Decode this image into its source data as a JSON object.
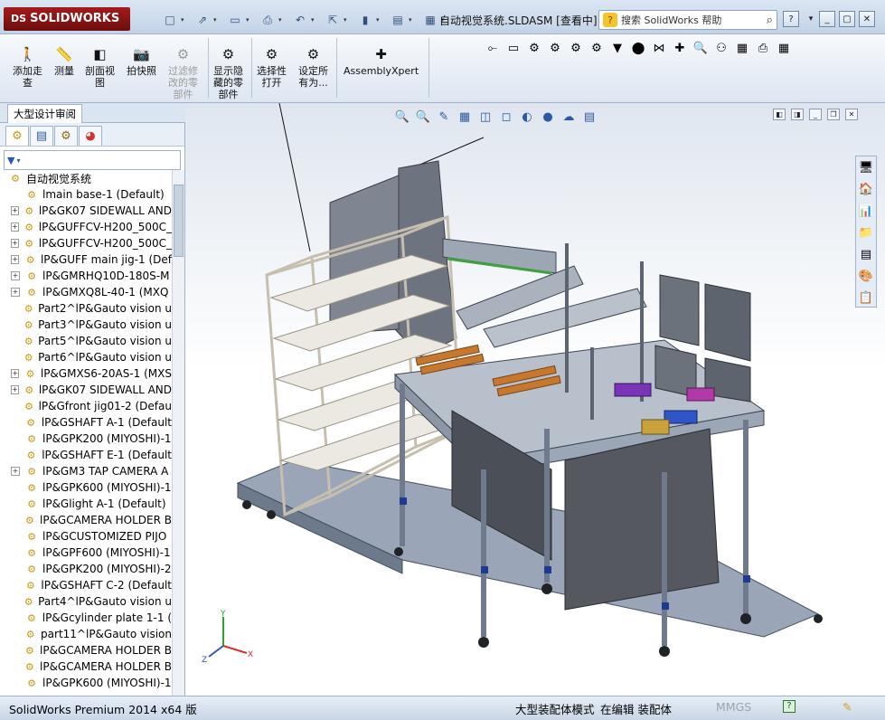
{
  "app": {
    "logo_text": "SOLIDWORKS",
    "logo_mark": "DS",
    "document_title": "自动视觉系统.SLDASM [查看中]",
    "help_search_placeholder": "搜索 SolidWorks 帮助",
    "help_icon_glyph": "?"
  },
  "quick_access": [
    {
      "name": "new-document-button",
      "glyph": "□"
    },
    {
      "name": "open-button",
      "glyph": "⇗"
    },
    {
      "name": "save-button",
      "glyph": "▭"
    },
    {
      "name": "print-button",
      "glyph": "⎙"
    },
    {
      "name": "undo-button",
      "glyph": "↶"
    },
    {
      "name": "select-button",
      "glyph": "⇱"
    },
    {
      "name": "rebuild-button",
      "glyph": "▮"
    },
    {
      "name": "file-properties-button",
      "glyph": "▤"
    },
    {
      "name": "options-button",
      "glyph": "▦"
    }
  ],
  "ribbon": {
    "buttons": [
      {
        "label": "添加走\n查",
        "name": "add-walkthrough-button",
        "glyph": "🚶",
        "disabled": false
      },
      {
        "label": "测量",
        "name": "measure-button",
        "glyph": "📏",
        "disabled": false
      },
      {
        "label": "剖面视\n图",
        "name": "section-view-button",
        "glyph": "◧",
        "disabled": false
      },
      {
        "label": "拍快照",
        "name": "take-snapshot-button",
        "glyph": "📷",
        "disabled": false
      },
      {
        "label": "过滤修\n改的零\n部件",
        "name": "filter-modified-button",
        "glyph": "⚙",
        "disabled": true
      },
      {
        "label": "显示隐\n藏的零\n部件",
        "name": "show-hidden-button",
        "glyph": "⚙",
        "disabled": false
      },
      {
        "label": "选择性\n打开",
        "name": "selective-open-button",
        "glyph": "⚙",
        "disabled": false
      },
      {
        "label": "设定所\n有为...",
        "name": "set-all-button",
        "glyph": "⚙",
        "disabled": false
      },
      {
        "label": "AssemblyXpert",
        "name": "assemblyxpert-button",
        "glyph": "✚",
        "disabled": false
      }
    ],
    "icon_row": [
      "⟜",
      "▭",
      "⚙",
      "⚙",
      "⚙",
      "⚙",
      "▼",
      "⬤",
      "⋈",
      "✚",
      "🔍",
      "⚇",
      "▦",
      "⎙",
      "▦"
    ]
  },
  "feature_manager": {
    "tab_label": "大型设计审阅",
    "panel_tabs": [
      "assembly",
      "properties",
      "configuration",
      "appearance"
    ],
    "filter_glyph": "▼",
    "root": "自动视觉系统",
    "items": [
      {
        "label": "lmain base-1 (Default)",
        "expandable": false
      },
      {
        "label": "lP&GK07 SIDEWALL AND",
        "expandable": true
      },
      {
        "label": "lP&GUFFCV-H200_500C_",
        "expandable": true
      },
      {
        "label": "lP&GUFFCV-H200_500C_",
        "expandable": true
      },
      {
        "label": "lP&GUFF main jig-1 (Def",
        "expandable": true
      },
      {
        "label": "lP&GMRHQ10D-180S-M",
        "expandable": true
      },
      {
        "label": "lP&GMXQ8L-40-1 (MXQ",
        "expandable": true
      },
      {
        "label": "Part2^lP&Gauto vision u",
        "expandable": false
      },
      {
        "label": "Part3^lP&Gauto vision u",
        "expandable": false
      },
      {
        "label": "Part5^lP&Gauto vision u",
        "expandable": false
      },
      {
        "label": "Part6^lP&Gauto vision u",
        "expandable": false
      },
      {
        "label": "lP&GMXS6-20AS-1 (MXS",
        "expandable": true
      },
      {
        "label": "lP&GK07 SIDEWALL AND",
        "expandable": true
      },
      {
        "label": "lP&Gfront jig01-2 (Defau",
        "expandable": false
      },
      {
        "label": "lP&GSHAFT A-1 (Default",
        "expandable": false
      },
      {
        "label": "lP&GPK200 (MIYOSHI)-1",
        "expandable": false
      },
      {
        "label": "lP&GSHAFT E-1 (Default",
        "expandable": false
      },
      {
        "label": "lP&GM3 TAP CAMERA A",
        "expandable": true
      },
      {
        "label": "lP&GPK600 (MIYOSHI)-1",
        "expandable": false
      },
      {
        "label": "lP&Glight A-1 (Default)",
        "expandable": false
      },
      {
        "label": "lP&GCAMERA HOLDER B",
        "expandable": false
      },
      {
        "label": "lP&GCUSTOMIZED PIJO",
        "expandable": false
      },
      {
        "label": "lP&GPF600 (MIYOSHI)-1",
        "expandable": false
      },
      {
        "label": "lP&GPK200 (MIYOSHI)-2",
        "expandable": false
      },
      {
        "label": "lP&GSHAFT C-2 (Default",
        "expandable": false
      },
      {
        "label": "Part4^lP&Gauto vision u",
        "expandable": false
      },
      {
        "label": "lP&Gcylinder plate 1-1 (",
        "expandable": false
      },
      {
        "label": "part11^lP&Gauto vision",
        "expandable": false
      },
      {
        "label": "lP&GCAMERA HOLDER B",
        "expandable": false
      },
      {
        "label": "lP&GCAMERA HOLDER B",
        "expandable": false
      },
      {
        "label": "lP&GPK600 (MIYOSHI)-1",
        "expandable": false
      }
    ]
  },
  "heads_up_toolbar": [
    "🔍",
    "🔍",
    "✎",
    "▦",
    "◫",
    "◻",
    "◐",
    "●",
    "☁",
    "▤"
  ],
  "task_pane": [
    "🖥",
    "🏠",
    "📊",
    "📁",
    "▤",
    "🎨",
    "📋"
  ],
  "statusbar": {
    "product": "SolidWorks Premium 2014 x64 版",
    "mode": "大型装配体模式",
    "editing": "在编辑 装配体",
    "units": "MMGS",
    "help_glyph": "?"
  },
  "triad_axes": [
    "Y",
    "X",
    "Z"
  ],
  "colors": {
    "title_gradient": "#c3d3e7",
    "accent_blue": "#2a59a8",
    "solidworks_red": "#a41b1b",
    "frame_aluminum": "#8b97a8",
    "panel_dark": "#4b4f57"
  }
}
